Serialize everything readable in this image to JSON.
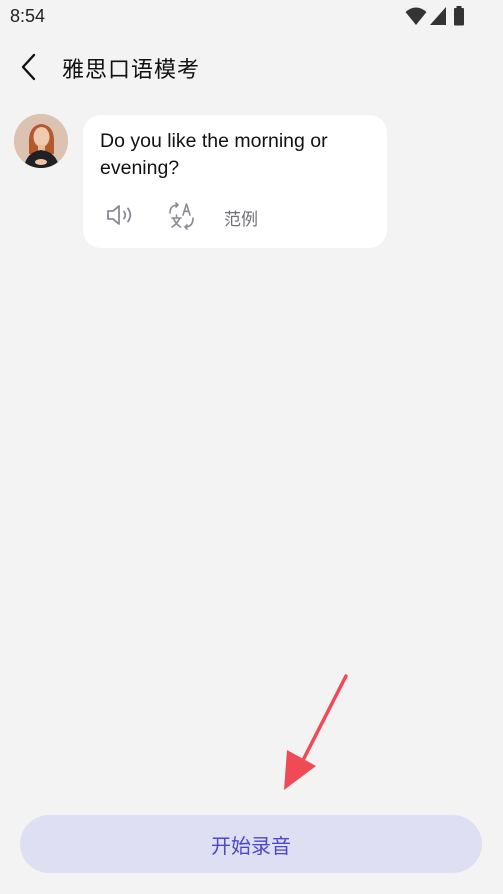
{
  "status_bar": {
    "time": "8:54",
    "icons": [
      "wifi-icon",
      "cell-signal-icon",
      "battery-icon"
    ]
  },
  "header": {
    "back_icon": "chevron-left-icon",
    "title": "雅思口语模考"
  },
  "message": {
    "avatar": "examiner-avatar",
    "text": "Do you like the morning or evening?",
    "actions": {
      "speaker_icon": "speaker-icon",
      "translate_icon": "translate-icon",
      "example_label": "范例"
    }
  },
  "footer": {
    "record_label": "开始录音"
  },
  "colors": {
    "background": "#f3f3f3",
    "bubble": "#ffffff",
    "record_button_bg": "#dedff3",
    "record_button_text": "#4f47c9",
    "annotation_arrow": "#ef4a55"
  }
}
